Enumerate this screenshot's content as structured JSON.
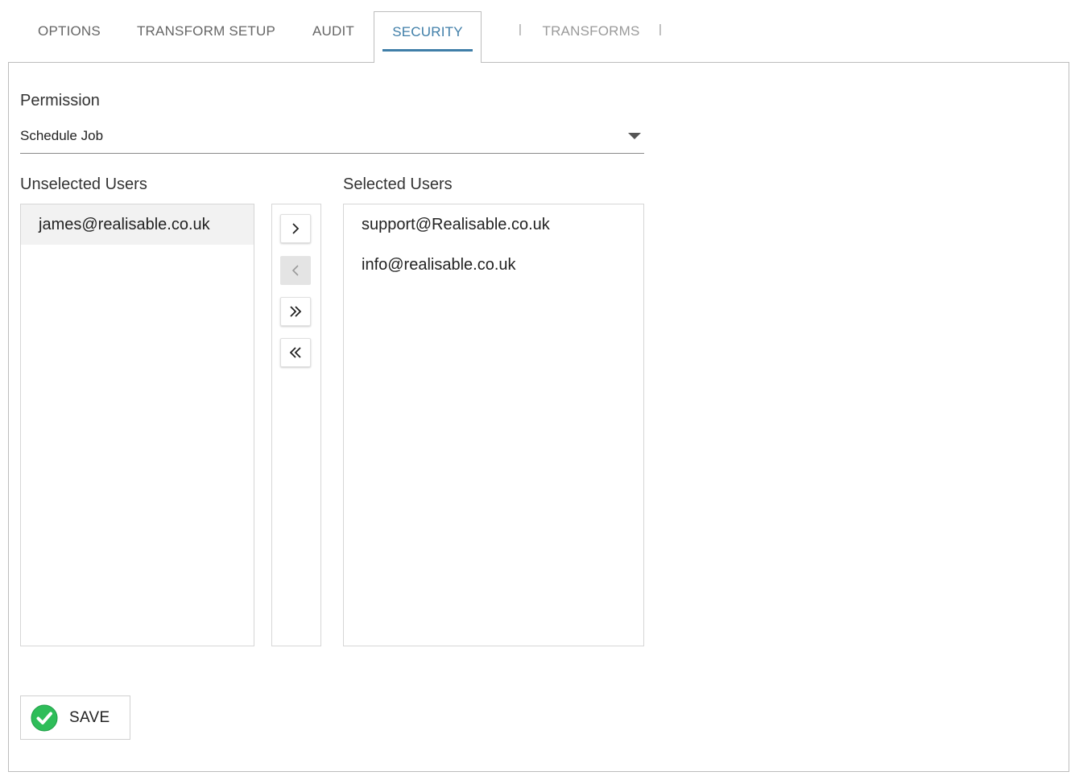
{
  "tabs": [
    {
      "label": "OPTIONS",
      "active": false
    },
    {
      "label": "TRANSFORM SETUP",
      "active": false
    },
    {
      "label": "AUDIT",
      "active": false
    },
    {
      "label": "SECURITY",
      "active": true
    },
    {
      "label": "TRANSFORMS",
      "active": false
    }
  ],
  "separator": "|",
  "permission": {
    "label": "Permission",
    "selected": "Schedule Job"
  },
  "unselected": {
    "label": "Unselected Users",
    "items": [
      "james@realisable.co.uk"
    ]
  },
  "selected": {
    "label": "Selected Users",
    "items": [
      "support@Realisable.co.uk",
      "info@realisable.co.uk"
    ]
  },
  "move_buttons": [
    {
      "icon": "chevron-right-icon",
      "glyph": "›",
      "enabled": true
    },
    {
      "icon": "chevron-left-icon",
      "glyph": "‹",
      "enabled": false
    },
    {
      "icon": "double-chevron-right-icon",
      "glyph": "»",
      "enabled": true
    },
    {
      "icon": "double-chevron-left-icon",
      "glyph": "«",
      "enabled": true
    }
  ],
  "save": {
    "label": "SAVE",
    "icon": "check-circle-icon"
  },
  "colors": {
    "accent": "#3f7ea8",
    "save_icon": "#2ebd59"
  }
}
